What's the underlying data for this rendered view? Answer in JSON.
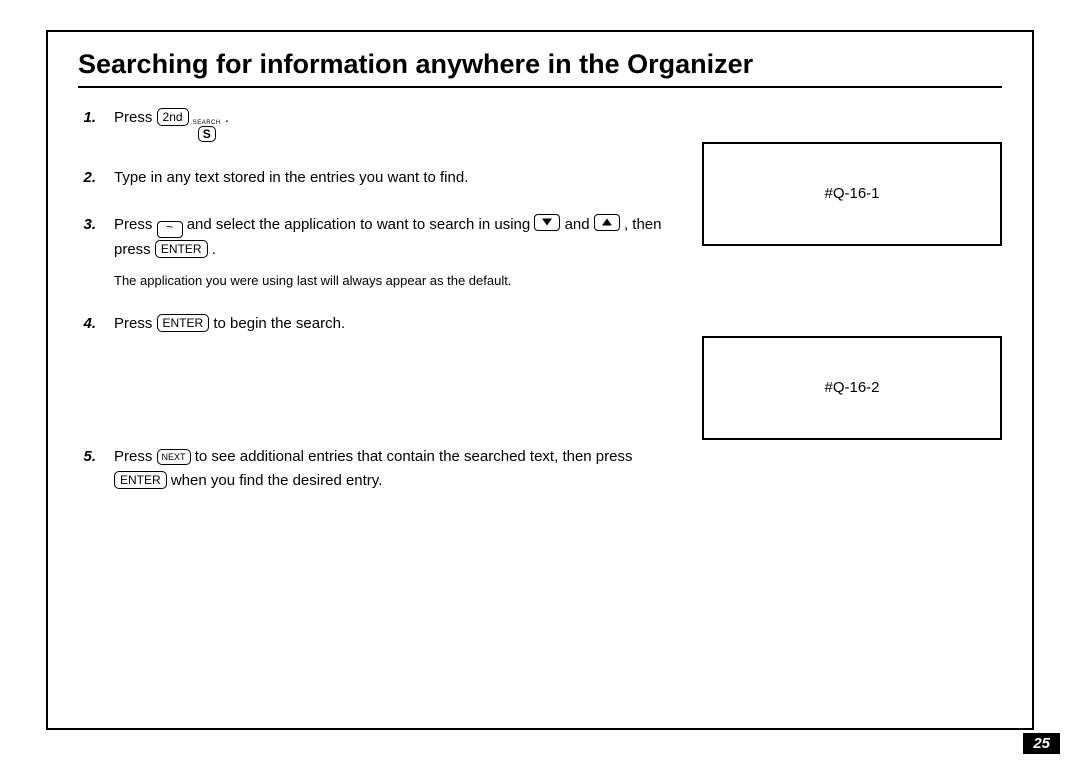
{
  "title": "Searching for information anywhere in the Organizer",
  "steps": {
    "n1": "1.",
    "s1_a": "Press ",
    "s1_key_2nd": "2nd",
    "s1_key_s_sup": "SEARCH",
    "s1_key_s": "S",
    "s1_b": " .",
    "n2": "2.",
    "s2": "Type in any text stored in the entries you want to find.",
    "n3": "3.",
    "s3_a": "Press ",
    "s3_b": " and select the application to want to search in using ",
    "s3_c": " and ",
    "s3_d": ", then press ",
    "s3_key_enter": "ENTER",
    "s3_e": " .",
    "note": "The application you were using last will always appear as the default.",
    "n4": "4.",
    "s4_a": "Press ",
    "s4_key_enter": "ENTER",
    "s4_b": " to begin the search.",
    "n5": "5.",
    "s5_a": "Press ",
    "s5_key_next": "NEXT",
    "s5_b": " to see additional entries that contain the searched text, then press ",
    "s5_key_enter": "ENTER",
    "s5_c": " when you find the desired entry."
  },
  "side": {
    "box1": "#Q-16-1",
    "box2": "#Q-16-2"
  },
  "page_number": "25",
  "tilde": "~"
}
